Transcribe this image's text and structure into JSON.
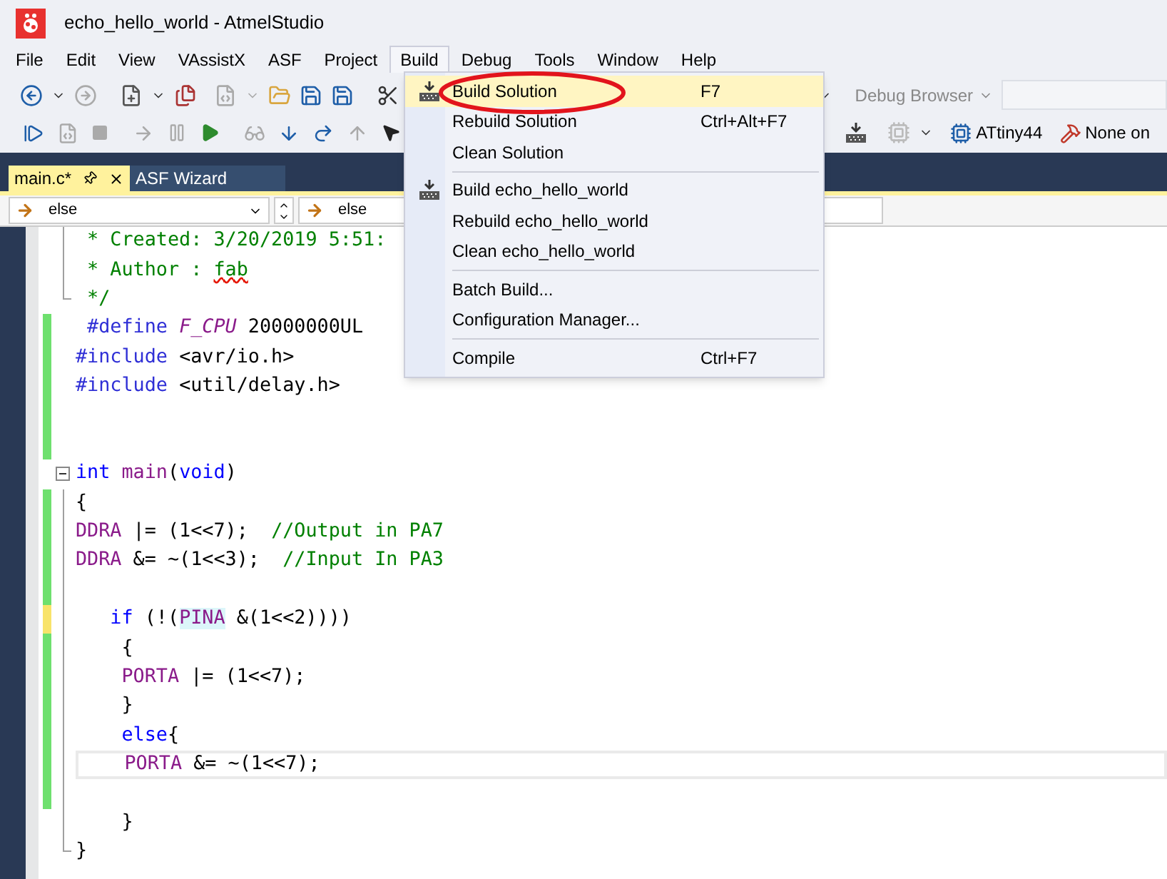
{
  "window": {
    "title": "echo_hello_world - AtmelStudio"
  },
  "menu_bar": [
    {
      "label": "File",
      "selected": false
    },
    {
      "label": "Edit",
      "selected": false
    },
    {
      "label": "View",
      "selected": false
    },
    {
      "label": "VAssistX",
      "selected": false
    },
    {
      "label": "ASF",
      "selected": false
    },
    {
      "label": "Project",
      "selected": false
    },
    {
      "label": "Build",
      "selected": true
    },
    {
      "label": "Debug",
      "selected": false
    },
    {
      "label": "Tools",
      "selected": false
    },
    {
      "label": "Window",
      "selected": false
    },
    {
      "label": "Help",
      "selected": false
    }
  ],
  "toolbar": {
    "debug_browser": "Debug Browser",
    "device": "ATtiny44",
    "tool": "None on"
  },
  "tabs": [
    {
      "label": "main.c*",
      "selected": true
    },
    {
      "label": "ASF Wizard",
      "selected": false
    }
  ],
  "navigation": [
    {
      "value": "else"
    },
    {
      "value": "else"
    }
  ],
  "build_menu": [
    {
      "kind": "item",
      "label": "Build Solution",
      "shortcut": "F7",
      "icon": true,
      "selected": true
    },
    {
      "kind": "item",
      "label": "Rebuild Solution",
      "shortcut": "Ctrl+Alt+F7",
      "icon": false,
      "selected": false
    },
    {
      "kind": "item",
      "label": "Clean Solution",
      "icon": false,
      "selected": false
    },
    {
      "kind": "separator"
    },
    {
      "kind": "item",
      "label": "Build echo_hello_world",
      "icon": true,
      "selected": false
    },
    {
      "kind": "item",
      "label": "Rebuild echo_hello_world",
      "icon": false,
      "selected": false
    },
    {
      "kind": "item",
      "label": "Clean echo_hello_world",
      "icon": false,
      "selected": false
    },
    {
      "kind": "separator"
    },
    {
      "kind": "item",
      "label": "Batch Build...",
      "icon": false,
      "selected": false
    },
    {
      "kind": "item",
      "label": "Configuration Manager...",
      "icon": false,
      "selected": false
    },
    {
      "kind": "separator"
    },
    {
      "kind": "item",
      "label": "Compile",
      "shortcut": "Ctrl+F7",
      "icon": false,
      "selected": false
    }
  ],
  "editor": {
    "lines": [
      {
        "modified": false,
        "unsaved": false,
        "outlined": true,
        "collapsible": false,
        "tokens": [
          {
            "t": " * Created: 3/20/2019 5:51:",
            "kind": "comment"
          }
        ]
      },
      {
        "modified": false,
        "unsaved": false,
        "outlined": true,
        "collapsible": false,
        "tokens": [
          {
            "t": " * Author : ",
            "kind": "comment"
          },
          {
            "t": "fab",
            "kind": "misspelled"
          }
        ]
      },
      {
        "modified": false,
        "unsaved": false,
        "outlined": true,
        "collapsible": false,
        "tokens": [
          {
            "t": " */",
            "kind": "comment"
          }
        ]
      },
      {
        "modified": true,
        "unsaved": false,
        "outlined": false,
        "collapsible": false,
        "tokens": [
          {
            "t": " #define ",
            "kind": "preproc"
          },
          {
            "t": "F_CPU",
            "kind": "macro"
          },
          {
            "t": " 20000000UL",
            "kind": "plain"
          }
        ]
      },
      {
        "modified": true,
        "unsaved": false,
        "outlined": false,
        "collapsible": false,
        "tokens": [
          {
            "t": "#include ",
            "kind": "preproc"
          },
          {
            "t": "<avr/io.h>",
            "kind": "plain"
          }
        ]
      },
      {
        "modified": true,
        "unsaved": false,
        "outlined": false,
        "collapsible": false,
        "tokens": [
          {
            "t": "#include ",
            "kind": "preproc"
          },
          {
            "t": "<util/delay.h>",
            "kind": "plain"
          }
        ]
      },
      {
        "modified": true,
        "unsaved": false,
        "outlined": false,
        "collapsible": false
      },
      {
        "modified": true,
        "unsaved": false,
        "outlined": false,
        "collapsible": false
      },
      {
        "modified": false,
        "unsaved": false,
        "outlined": false,
        "collapsible": true,
        "tokens": [
          {
            "t": "int",
            "kind": "keyword"
          },
          {
            "t": " main",
            "kind": "symbol"
          },
          {
            "t": "(",
            "kind": "plain"
          },
          {
            "t": "void",
            "kind": "keyword"
          },
          {
            "t": ")",
            "kind": "plain"
          }
        ]
      },
      {
        "modified": true,
        "unsaved": false,
        "outlined": true,
        "collapsible": false,
        "tokens": [
          {
            "t": "{",
            "kind": "plain"
          }
        ]
      },
      {
        "modified": true,
        "unsaved": false,
        "outlined": true,
        "collapsible": false,
        "tokens": [
          {
            "t": "DDRA",
            "kind": "symbol"
          },
          {
            "t": " |= (1<<7);  ",
            "kind": "plain"
          },
          {
            "t": "//Output in PA7",
            "kind": "comment"
          }
        ]
      },
      {
        "modified": true,
        "unsaved": false,
        "outlined": true,
        "collapsible": false,
        "tokens": [
          {
            "t": "DDRA",
            "kind": "symbol"
          },
          {
            "t": " &= ~(1<<3);  ",
            "kind": "plain"
          },
          {
            "t": "//Input In PA3",
            "kind": "comment"
          }
        ]
      },
      {
        "modified": true,
        "unsaved": false,
        "outlined": true,
        "collapsible": false
      },
      {
        "modified": true,
        "unsaved": true,
        "outlined": true,
        "collapsible": false,
        "tokens": [
          {
            "t": "   if",
            "kind": "keyword"
          },
          {
            "t": " (!(",
            "kind": "plain"
          },
          {
            "t": "PINA",
            "kind": "highlight"
          },
          {
            "t": " &(1<<2))))",
            "kind": "plain"
          }
        ]
      },
      {
        "modified": true,
        "unsaved": false,
        "outlined": true,
        "collapsible": false,
        "tokens": [
          {
            "t": "    {",
            "kind": "plain"
          }
        ]
      },
      {
        "modified": true,
        "unsaved": false,
        "outlined": true,
        "collapsible": false,
        "tokens": [
          {
            "t": "    PORTA",
            "kind": "symbol"
          },
          {
            "t": " |= (1<<7);",
            "kind": "plain"
          }
        ]
      },
      {
        "modified": true,
        "unsaved": false,
        "outlined": true,
        "collapsible": false,
        "tokens": [
          {
            "t": "    }",
            "kind": "plain"
          }
        ]
      },
      {
        "modified": true,
        "unsaved": false,
        "outlined": true,
        "collapsible": false,
        "tokens": [
          {
            "t": "    else",
            "kind": "keyword"
          },
          {
            "t": "{",
            "kind": "plain"
          }
        ]
      },
      {
        "modified": true,
        "unsaved": false,
        "outlined": true,
        "collapsible": false,
        "current": true,
        "tokens": [
          {
            "t": "    PORTA",
            "kind": "symbol"
          },
          {
            "t": " &= ~(1<<7);",
            "kind": "plain"
          }
        ]
      },
      {
        "modified": true,
        "unsaved": false,
        "outlined": true,
        "collapsible": false
      },
      {
        "modified": false,
        "unsaved": false,
        "outlined": true,
        "collapsible": false,
        "tokens": [
          {
            "t": "    }",
            "kind": "plain"
          }
        ]
      },
      {
        "modified": false,
        "unsaved": false,
        "outlined": true,
        "collapsible": false,
        "tokens": [
          {
            "t": "}",
            "kind": "plain"
          }
        ]
      }
    ]
  }
}
